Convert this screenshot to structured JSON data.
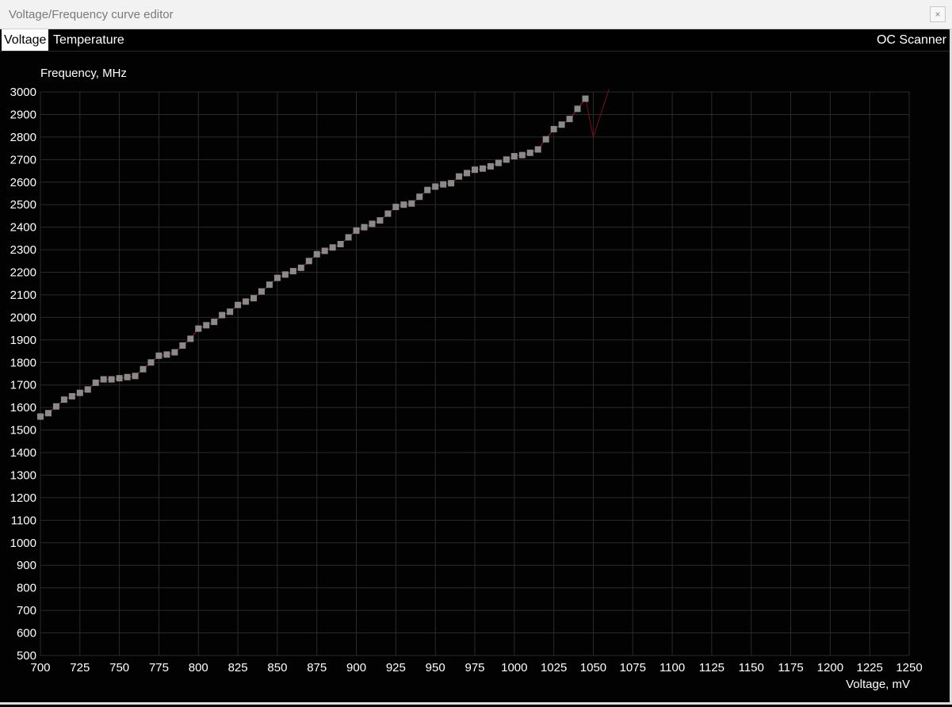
{
  "window": {
    "title": "Voltage/Frequency curve editor",
    "close_glyph": "×"
  },
  "tabs": [
    {
      "label": "Voltage",
      "active": true
    },
    {
      "label": "Temperature",
      "active": false
    }
  ],
  "oc_scanner_label": "OC Scanner",
  "chart_data": {
    "type": "scatter",
    "ylabel": "Frequency, MHz",
    "xlabel": "Voltage, mV",
    "xlim": [
      700,
      1250
    ],
    "ylim": [
      500,
      3000
    ],
    "x_ticks": [
      700,
      725,
      750,
      775,
      800,
      825,
      850,
      875,
      900,
      925,
      950,
      975,
      1000,
      1025,
      1050,
      1075,
      1100,
      1125,
      1150,
      1175,
      1200,
      1225,
      1250
    ],
    "y_ticks": [
      500,
      600,
      700,
      800,
      900,
      1000,
      1100,
      1200,
      1300,
      1400,
      1500,
      1600,
      1700,
      1800,
      1900,
      2000,
      2100,
      2200,
      2300,
      2400,
      2500,
      2600,
      2700,
      2800,
      2900,
      3000
    ],
    "grid": true,
    "colors": {
      "background": "#020202",
      "grid": "#2b2b2b",
      "curve": "#c0111b",
      "point": "#8a8a8a",
      "text": "#ffffff"
    },
    "series": [
      {
        "x": [
          700,
          705,
          710,
          715,
          720,
          725,
          730,
          735,
          740,
          745,
          750,
          755,
          760,
          765,
          770,
          775,
          780,
          785,
          790,
          795,
          800,
          805,
          810,
          815,
          820,
          825,
          830,
          835,
          840,
          845,
          850,
          855,
          860,
          865,
          870,
          875,
          880,
          885,
          890,
          895,
          900,
          905,
          910,
          915,
          920,
          925,
          930,
          935,
          940,
          945,
          950,
          955,
          960,
          965,
          970,
          975,
          980,
          985,
          990,
          995,
          1000,
          1005,
          1010,
          1015,
          1020,
          1025,
          1030,
          1035,
          1040,
          1045
        ],
        "y": [
          1560,
          1575,
          1605,
          1635,
          1650,
          1665,
          1680,
          1710,
          1725,
          1725,
          1730,
          1735,
          1740,
          1770,
          1800,
          1830,
          1835,
          1845,
          1875,
          1905,
          1950,
          1965,
          1980,
          2010,
          2025,
          2055,
          2070,
          2085,
          2115,
          2145,
          2175,
          2190,
          2205,
          2220,
          2250,
          2280,
          2295,
          2310,
          2325,
          2355,
          2385,
          2400,
          2415,
          2430,
          2460,
          2490,
          2500,
          2505,
          2535,
          2565,
          2580,
          2590,
          2595,
          2625,
          2640,
          2655,
          2660,
          2670,
          2685,
          2700,
          2715,
          2720,
          2730,
          2745,
          2790,
          2835,
          2855,
          2880,
          2925,
          2970
        ]
      }
    ],
    "overshoot_line": {
      "x": [
        1045,
        1050,
        1060
      ],
      "y": [
        2975,
        2800,
        3060
      ]
    }
  }
}
